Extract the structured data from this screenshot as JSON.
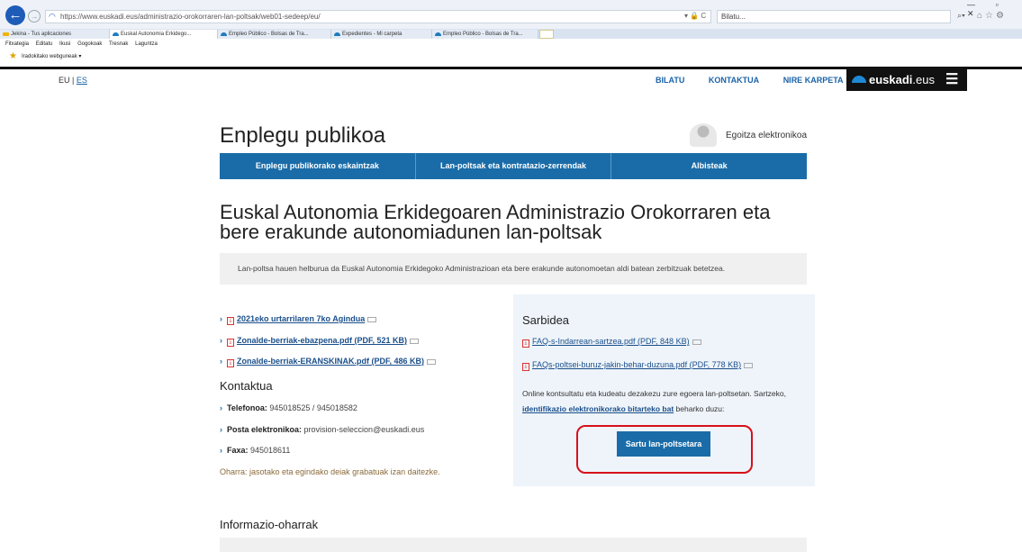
{
  "browser": {
    "url": "https://www.euskadi.eus/administrazio-orokorraren-lan-poltsak/web01-sedeep/eu/",
    "url_tools": "▾ 🔒 C",
    "search_placeholder": "Bilatu...",
    "window_controls": "— ▫ ✕",
    "tabs": [
      {
        "label": "Jekina - Tus aplicaciones"
      },
      {
        "label": "Euskal Autonomia Erkidego..."
      },
      {
        "label": "Empleo Público - Bolsas de Tra..."
      },
      {
        "label": "Expedientes - Mi carpeta"
      },
      {
        "label": "Empleo Público - Bolsas de Tra..."
      }
    ],
    "menu": [
      "Fitxategia",
      "Editatu",
      "Ikusi",
      "Gogokoak",
      "Tresnak",
      "Laguntza"
    ],
    "favorites_label": "Iradokitako webguneak ▾"
  },
  "site": {
    "lang_eu": "EU",
    "lang_sep": " | ",
    "lang_es": "ES",
    "topnav": [
      "BILATU",
      "KONTAKTUA",
      "NIRE KARPETA"
    ],
    "brand_name": "euskadi",
    "brand_tld": ".eus"
  },
  "page": {
    "title": "Enplegu publikoa",
    "egoitza": "Egoitza elektronikoa",
    "nav": [
      "Enplegu publikorako eskaintzak",
      "Lan-poltsak eta kontratazio-zerrendak",
      "Albisteak"
    ],
    "heading": "Euskal Autonomia Erkidegoaren Administrazio Orokorraren eta bere erakunde autonomiadunen lan-poltsak",
    "intro": "Lan-poltsa hauen helburua da Euskal Autonomia Erkidegoko Administrazioan eta bere erakunde autonomoetan aldi batean zerbitzuak betetzea.",
    "documents": [
      {
        "label": "2021eko urtarrilaren 7ko Agindua"
      },
      {
        "label": "Zonalde-berriak-ebazpena.pdf (PDF, 521 KB)"
      },
      {
        "label": "Zonalde-berriak-ERANSKINAK.pdf (PDF, 486 KB)"
      }
    ],
    "contact": {
      "title": "Kontaktua",
      "phone_label": "Telefonoa:",
      "phone_value": " 945018525 / 945018582",
      "email_label": "Posta elektronikoa:",
      "email_value": " provision-seleccion@euskadi.eus",
      "fax_label": "Faxa:",
      "fax_value": " 945018611"
    },
    "note": "Oharra: jasotako eta egindako deiak grabatuak izan daitezke.",
    "access": {
      "title": "Sarbidea",
      "faqs": [
        {
          "label": "FAQ-s-Indarrean-sartzea.pdf (PDF, 848 KB)"
        },
        {
          "label": "FAQs-poltsei-buruz-jakin-behar-duzuna.pdf (PDF, 778 KB)"
        }
      ],
      "online_text_1": "Online kontsultatu eta kudeatu dezakezu zure egoera lan-poltsetan. Sartzeko,",
      "online_link": "identifikazio elektronikorako bitarteko bat",
      "online_text_2": " beharko duzu:",
      "button": "Sartu lan-poltsetara"
    },
    "info_title": "Informazio-oharrak"
  }
}
